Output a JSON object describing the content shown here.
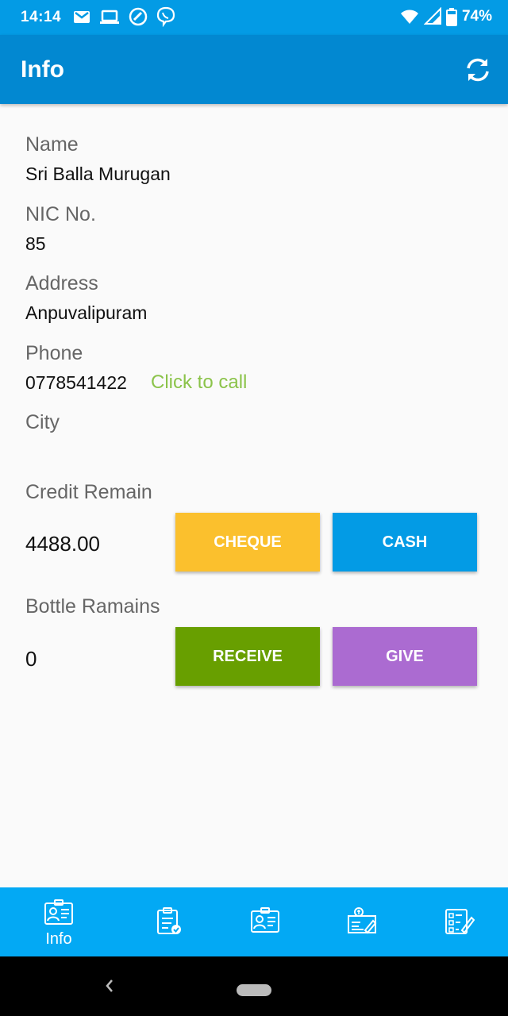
{
  "status_bar": {
    "time": "14:14",
    "battery": "74%",
    "icons": [
      "gmail-icon",
      "laptop-icon",
      "vpn-icon",
      "viber-icon",
      "wifi-icon",
      "signal-icon",
      "battery-icon"
    ]
  },
  "app_bar": {
    "title": "Info",
    "refresh_icon": "refresh-icon"
  },
  "info": {
    "name_label": "Name",
    "name_value": "Sri Balla Murugan",
    "nic_label": "NIC No.",
    "nic_value": "85",
    "address_label": "Address",
    "address_value": "Anpuvalipuram",
    "phone_label": "Phone",
    "phone_value": "0778541422",
    "call_link": "Click to call",
    "city_label": "City",
    "city_value": ""
  },
  "credit": {
    "label": "Credit Remain",
    "value": "4488.00",
    "cheque_button": "CHEQUE",
    "cash_button": "CASH"
  },
  "bottle": {
    "label": "Bottle Ramains",
    "value": "0",
    "receive_button": "RECEIVE",
    "give_button": "GIVE"
  },
  "colors": {
    "status_bar": "#039be5",
    "app_bar": "#0288d1",
    "bottom_nav": "#03a9f4",
    "cheque": "#fbc02d",
    "cash": "#039be5",
    "receive": "#689f00",
    "give": "#ab6bd1",
    "call_link": "#8bc34a"
  },
  "bottom_nav": {
    "items": [
      {
        "icon": "contact-card-icon",
        "label": "Info"
      },
      {
        "icon": "clipboard-check-icon",
        "label": ""
      },
      {
        "icon": "id-card-icon",
        "label": ""
      },
      {
        "icon": "payment-document-icon",
        "label": ""
      },
      {
        "icon": "checklist-edit-icon",
        "label": ""
      }
    ]
  }
}
